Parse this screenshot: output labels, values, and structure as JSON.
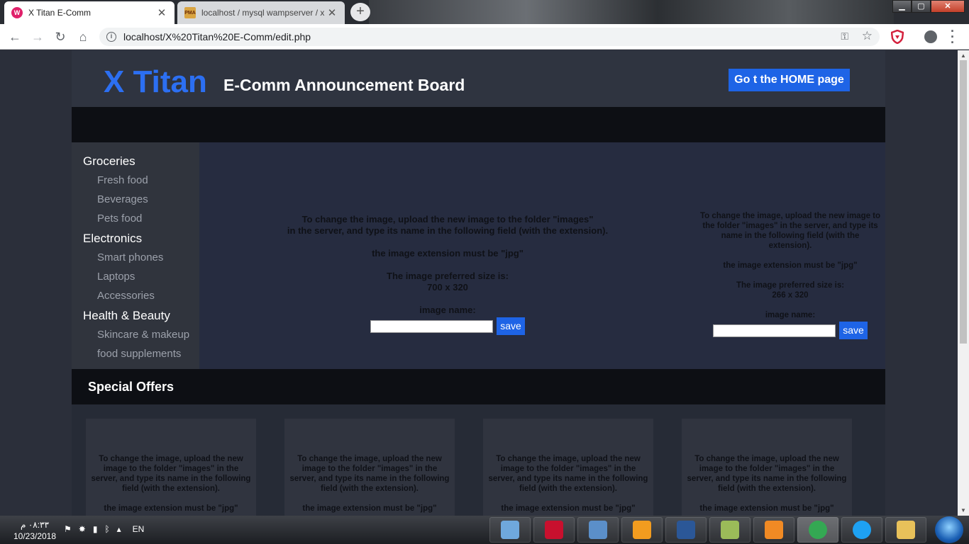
{
  "browser": {
    "tabs": [
      {
        "title": "X Titan E-Comm",
        "favicon": "W",
        "active": true
      },
      {
        "title": "localhost / mysql wampserver / x",
        "favicon": "PMA",
        "active": false
      }
    ],
    "new_tab": "+",
    "url": "localhost/X%20Titan%20E-Comm/edit.php"
  },
  "header": {
    "logo": "X Titan",
    "title": "E-Comm Announcement Board",
    "home_button": "Go t the HOME page"
  },
  "sidebar": {
    "groups": [
      {
        "label": "Groceries",
        "items": [
          "Fresh food",
          "Beverages",
          "Pets food"
        ]
      },
      {
        "label": "Electronics",
        "items": [
          "Smart phones",
          "Laptops",
          "Accessories"
        ]
      },
      {
        "label": "Health & Beauty",
        "items": [
          "Skincare & makeup",
          "food supplements"
        ]
      }
    ]
  },
  "banner": {
    "main": {
      "instructions": "To change the image, upload the new image to the folder \"images\"\nin the server, and type its name in the following field (with the extension).",
      "extension_note": "the image extension must be \"jpg\"",
      "size_label": "The image preferred size is:",
      "size_value": "700 x 320",
      "field_label": "image name:",
      "input_value": "",
      "save_label": "save"
    },
    "side": {
      "instructions": "To change the image, upload the new image to\nthe folder \"images\" in the server, and type its\nname in the following field (with the\nextension).",
      "extension_note": "the image extension must be \"jpg\"",
      "size_label": "The image preferred size is:",
      "size_value": "266 x 320",
      "field_label": "image name:",
      "input_value": "",
      "save_label": "save"
    }
  },
  "offers": {
    "title": "Special Offers",
    "cards": [
      {
        "instructions": "To change the image, upload the new\nimage to the folder \"images\" in the\nserver, and type its name in the following\nfield (with the extension).",
        "extension_note": "the image extension must be \"jpg\""
      },
      {
        "instructions": "To change the image, upload the new\nimage to the folder \"images\" in the\nserver, and type its name in the following\nfield (with the extension).",
        "extension_note": "the image extension must be \"jpg\""
      },
      {
        "instructions": "To change the image, upload the new\nimage to the folder \"images\" in the\nserver, and type its name in the following\nfield (with the extension).",
        "extension_note": "the image extension must be \"jpg\""
      },
      {
        "instructions": "To change the image, upload the new\nimage to the folder \"images\" in the\nserver, and type its name in the following\nfield (with the extension).",
        "extension_note": "the image extension must be \"jpg\""
      }
    ]
  },
  "taskbar": {
    "time": "٠٨:٣٣ م",
    "date": "10/23/2018",
    "language": "EN",
    "apps": [
      {
        "name": "paint-icon",
        "color": "#6fa8dc"
      },
      {
        "name": "acrobat-icon",
        "color": "#c8102e"
      },
      {
        "name": "photo-viewer-icon",
        "color": "#5b8fc9"
      },
      {
        "name": "sublime-text-icon",
        "color": "#f29c1f"
      },
      {
        "name": "word-icon",
        "color": "#2b5797"
      },
      {
        "name": "notepad-icon",
        "color": "#9bbb59"
      },
      {
        "name": "media-player-icon",
        "color": "#f08a24"
      },
      {
        "name": "chrome-icon",
        "color": "#34a853"
      },
      {
        "name": "internet-explorer-icon",
        "color": "#1ea1f2"
      },
      {
        "name": "file-explorer-icon",
        "color": "#e8c15a"
      }
    ]
  },
  "colors": {
    "accent": "#1e64e6",
    "logo": "#2c6ff2",
    "page_background": "#2b2f3a",
    "bar": "#0d0f14"
  }
}
